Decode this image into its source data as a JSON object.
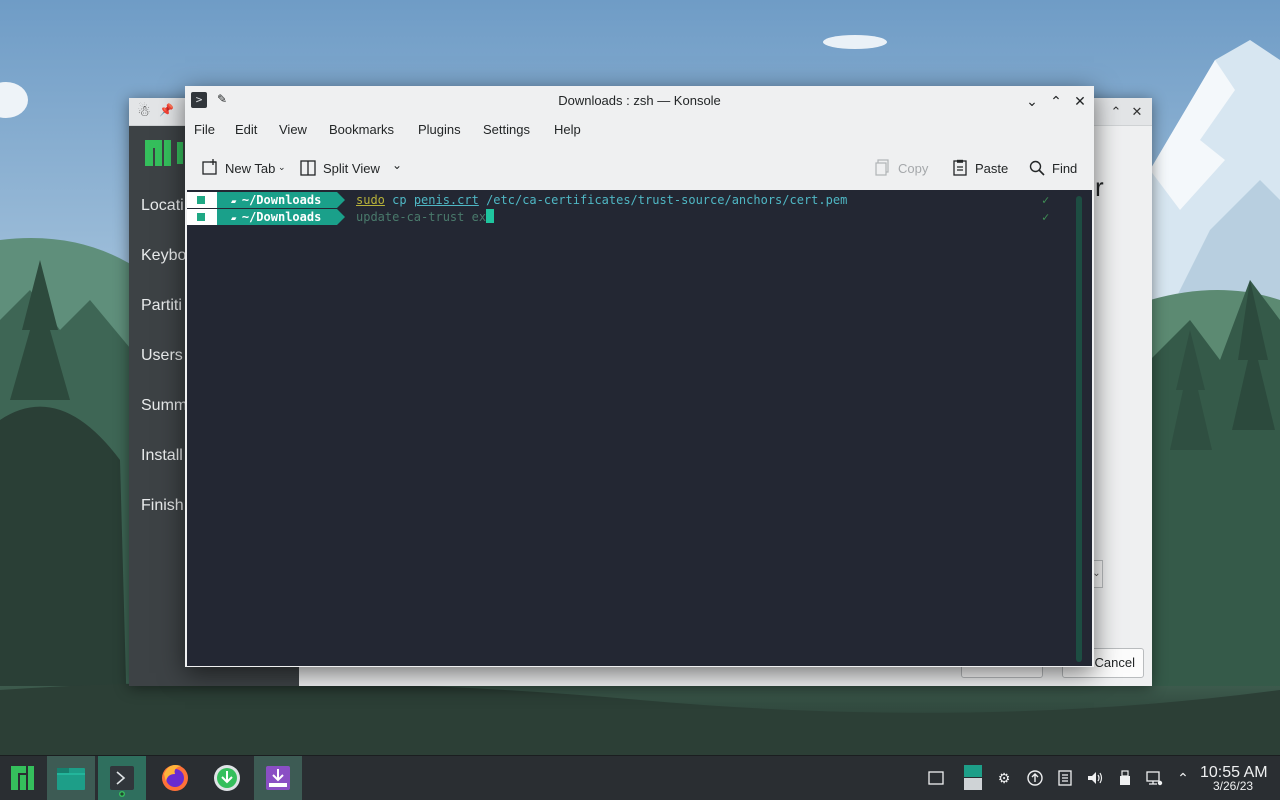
{
  "desktop": {
    "wallpaper": "mountain-forest"
  },
  "installer": {
    "sidebar_steps": [
      "Locati",
      "Keybo",
      "Partiti",
      "Users",
      "Summ",
      "Install",
      "Finish"
    ],
    "heading_fragment": "r",
    "cancel_label": "Cancel",
    "icons": {
      "app": "installer-icon",
      "pin": "pin-icon",
      "minimize": "chevron-up-icon",
      "close": "close-icon"
    }
  },
  "konsole": {
    "title": "Downloads : zsh — Konsole",
    "menu": [
      "File",
      "Edit",
      "View",
      "Bookmarks",
      "Plugins",
      "Settings",
      "Help"
    ],
    "toolbar": {
      "new_tab": "New Tab",
      "split_view": "Split View",
      "copy": "Copy",
      "paste": "Paste",
      "find": "Find"
    },
    "terminal": {
      "lines": [
        {
          "prompt_dir": "~/Downloads",
          "cmd_sudo": "sudo",
          "cmd_cp": " cp ",
          "cmd_file": "penis.crt",
          "cmd_rest": " /etc/ca-certificates/trust-source/anchors/cert.pem",
          "status": "✓"
        },
        {
          "prompt_dir": "~/Downloads",
          "cmd_text": "update-ca-trust ex",
          "status": "✓"
        }
      ]
    },
    "colors": {
      "terminal_bg": "#232733",
      "prompt_accent": "#1aa08a",
      "command_text": "#4fb7c4",
      "sudo_text": "#b7b23a"
    }
  },
  "taskbar": {
    "apps": [
      "manjaro-menu-icon",
      "file-manager-icon",
      "konsole-icon",
      "firefox-icon",
      "download-icon",
      "installer-icon"
    ],
    "tray": [
      "desktop-icon",
      "display-icon",
      "network-share-icon",
      "updates-icon",
      "clipboard-icon",
      "volume-icon",
      "usb-icon",
      "network-icon",
      "chevron-up-icon"
    ],
    "time": "10:55 AM",
    "date": "3/26/23"
  }
}
